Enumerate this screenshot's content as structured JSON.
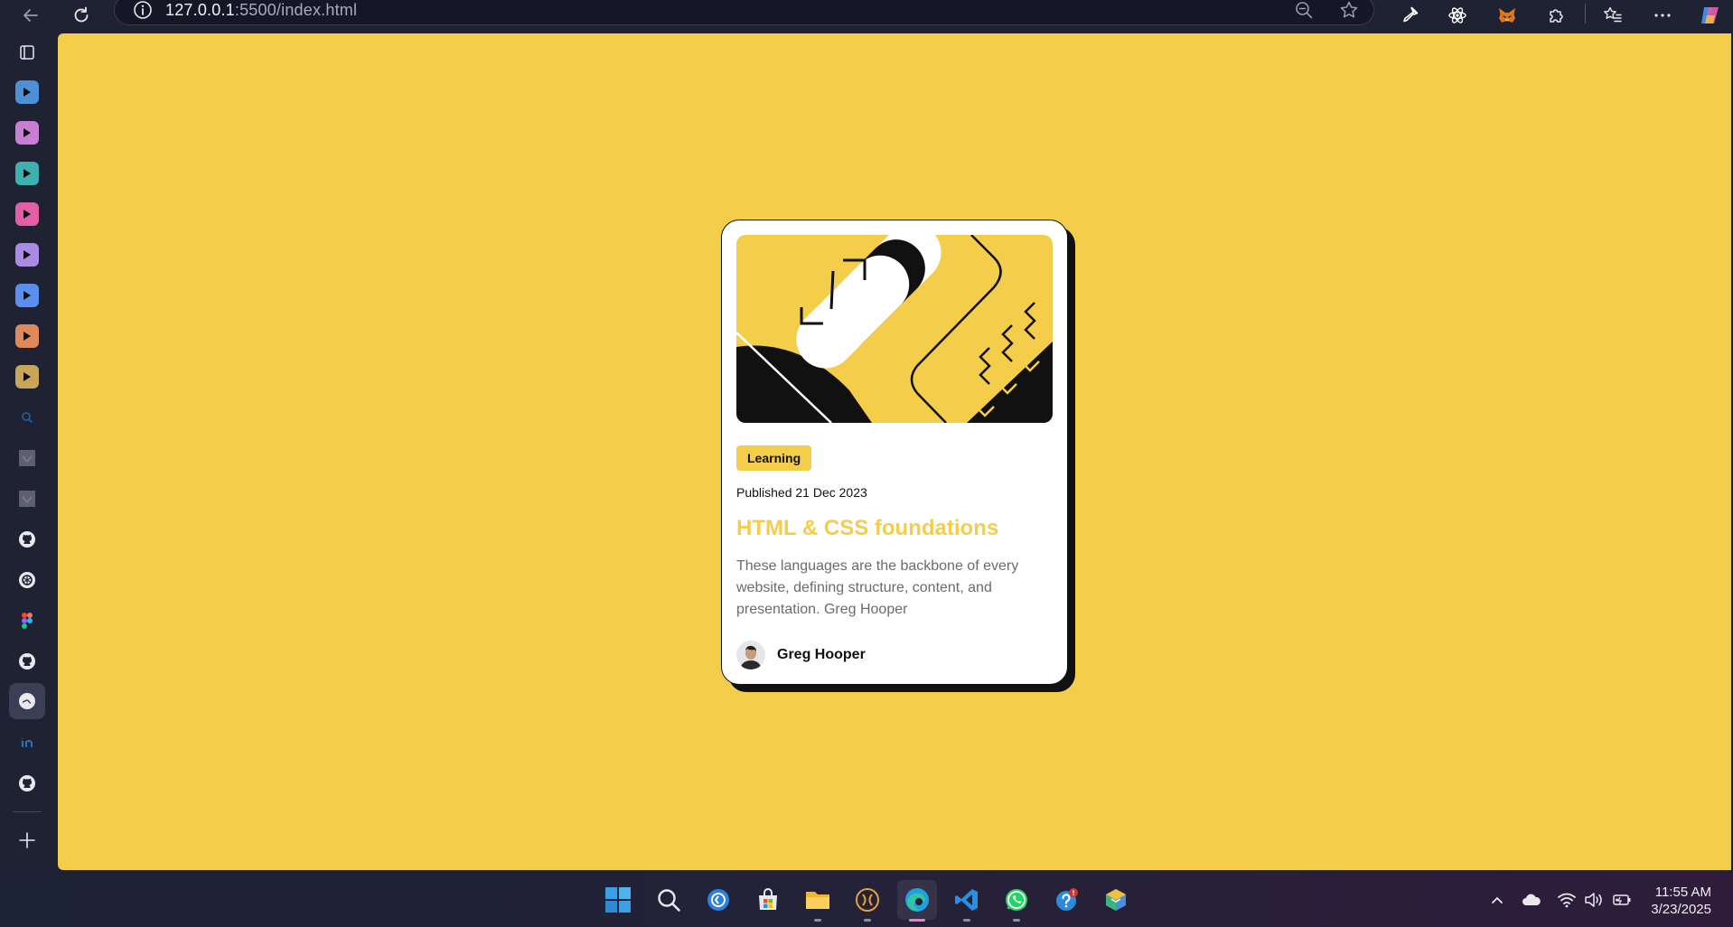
{
  "browser": {
    "url_host": "127.0.0.1",
    "url_path": ":5500/index.html"
  },
  "card": {
    "tag": "Learning",
    "published": "Published 21 Dec 2023",
    "title": "HTML & CSS foundations",
    "description": "These languages are the backbone of every website, defining structure, content, and presentation. Greg Hooper",
    "author": "Greg Hooper"
  },
  "colors": {
    "page_background": "#f4ce4b",
    "card_background": "#ffffff",
    "accent_yellow": "#f4ce4b",
    "text_dark": "#111111",
    "text_grey": "#6b6b6b",
    "browser_chrome": "#1f2233"
  },
  "sidebar": {
    "items": [
      {
        "icon": "tab-panel-icon"
      },
      {
        "icon": "play-icon",
        "color": "#4d90d6"
      },
      {
        "icon": "play-icon",
        "color": "#c97ed6"
      },
      {
        "icon": "play-icon",
        "color": "#3fb0b0"
      },
      {
        "icon": "play-icon",
        "color": "#e25fa8"
      },
      {
        "icon": "play-icon",
        "color": "#a98be6"
      },
      {
        "icon": "play-icon",
        "color": "#5a8ff0"
      },
      {
        "icon": "play-icon",
        "color": "#e08a5c"
      },
      {
        "icon": "play-icon",
        "color": "#c9a55a"
      },
      {
        "icon": "search-icon"
      },
      {
        "icon": "thumbnail-icon"
      },
      {
        "icon": "thumbnail-icon"
      },
      {
        "icon": "github-icon"
      },
      {
        "icon": "chatgpt-icon"
      },
      {
        "icon": "figma-icon"
      },
      {
        "icon": "github-icon"
      },
      {
        "icon": "globe-icon"
      },
      {
        "icon": "linkedin-icon"
      },
      {
        "icon": "github-icon"
      },
      {
        "icon": "plus-icon"
      }
    ]
  },
  "taskbar": {
    "time": "11:55 AM",
    "date": "3/23/2025"
  }
}
